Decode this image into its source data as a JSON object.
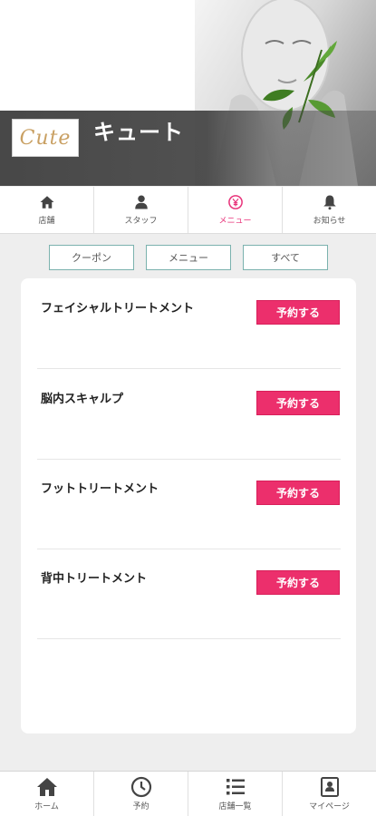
{
  "header": {
    "logo_text": "Cute",
    "salon_name": "キュート"
  },
  "top_nav": {
    "items": [
      {
        "label": "店舗",
        "icon": "home-icon",
        "active": false
      },
      {
        "label": "スタッフ",
        "icon": "person-icon",
        "active": false
      },
      {
        "label": "メニュー",
        "icon": "yen-icon",
        "active": true
      },
      {
        "label": "お知らせ",
        "icon": "bell-icon",
        "active": false
      }
    ]
  },
  "filters": {
    "items": [
      {
        "label": "クーポン"
      },
      {
        "label": "メニュー"
      },
      {
        "label": "すべて"
      }
    ]
  },
  "menu_list": {
    "items": [
      {
        "name": "フェイシャルトリートメント",
        "button": "予約する"
      },
      {
        "name": "脳内スキャルプ",
        "button": "予約する"
      },
      {
        "name": "フットトリートメント",
        "button": "予約する"
      },
      {
        "name": "背中トリートメント",
        "button": "予約する"
      }
    ]
  },
  "bottom_nav": {
    "items": [
      {
        "label": "ホーム",
        "icon": "home-icon"
      },
      {
        "label": "予約",
        "icon": "clock-icon"
      },
      {
        "label": "店舗一覧",
        "icon": "list-icon"
      },
      {
        "label": "マイページ",
        "icon": "profile-card-icon"
      }
    ]
  },
  "colors": {
    "accent_pink": "#ec2f6c",
    "active_nav": "#e8337a",
    "filter_border": "#7bb2ae",
    "logo_gold": "#c9a063",
    "header_band": "#404040"
  }
}
